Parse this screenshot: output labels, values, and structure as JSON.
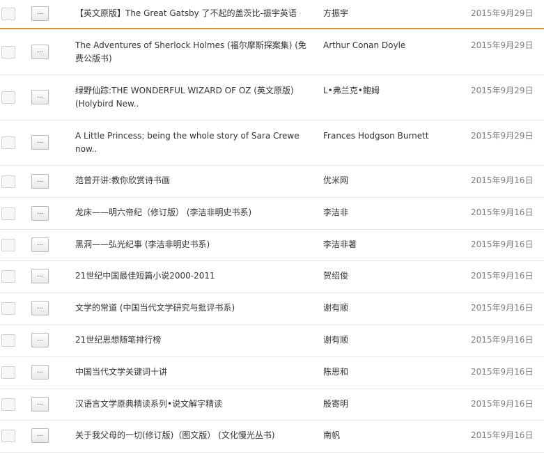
{
  "rows": [
    {
      "title": "【英文原版】The Great Gatsby 了不起的盖茨比-振宇英语",
      "author": "方振宇",
      "date": "2015年9月29日",
      "more": "..."
    },
    {
      "title": "The Adventures of Sherlock Holmes (福尔摩斯探案集) (免费公版书)",
      "author": "Arthur Conan Doyle",
      "date": "2015年9月29日",
      "more": "..."
    },
    {
      "title": "绿野仙踪:THE WONDERFUL WIZARD OF OZ (英文原版) (Holybird New..",
      "author": "L•弗兰克•鲍姆",
      "date": "2015年9月29日",
      "more": "..."
    },
    {
      "title": "A Little Princess; being the whole story of Sara Crewe now..",
      "author": "Frances Hodgson Burnett",
      "date": "2015年9月29日",
      "more": "..."
    },
    {
      "title": "范曾开讲:教你欣赏诗书画",
      "author": "优米网",
      "date": "2015年9月16日",
      "more": "..."
    },
    {
      "title": "龙床——明六帝纪（修订版） (李洁非明史书系)",
      "author": "李洁非",
      "date": "2015年9月16日",
      "more": "..."
    },
    {
      "title": "黑洞——弘光纪事 (李洁非明史书系)",
      "author": "李洁非著",
      "date": "2015年9月16日",
      "more": "..."
    },
    {
      "title": "21世纪中国最佳短篇小说2000-2011",
      "author": "贺绍俊",
      "date": "2015年9月16日",
      "more": "..."
    },
    {
      "title": "文学的常道 (中国当代文学研究与批评书系)",
      "author": "谢有顺",
      "date": "2015年9月16日",
      "more": "..."
    },
    {
      "title": "21世纪思想随笔排行榜",
      "author": "谢有顺",
      "date": "2015年9月16日",
      "more": "..."
    },
    {
      "title": "中国当代文学关键词十讲",
      "author": "陈思和",
      "date": "2015年9月16日",
      "more": "..."
    },
    {
      "title": "汉语言文学原典精读系列•说文解字精读",
      "author": "殷寄明",
      "date": "2015年9月16日",
      "more": "..."
    },
    {
      "title": "关于我父母的一切(修订版)（图文版） (文化慢光丛书)",
      "author": "南帆",
      "date": "2015年9月16日",
      "more": "..."
    }
  ],
  "colors": {
    "selected_border": "#e58a2d",
    "date_text": "#7f7f7f",
    "divider": "#e6e6e6"
  }
}
